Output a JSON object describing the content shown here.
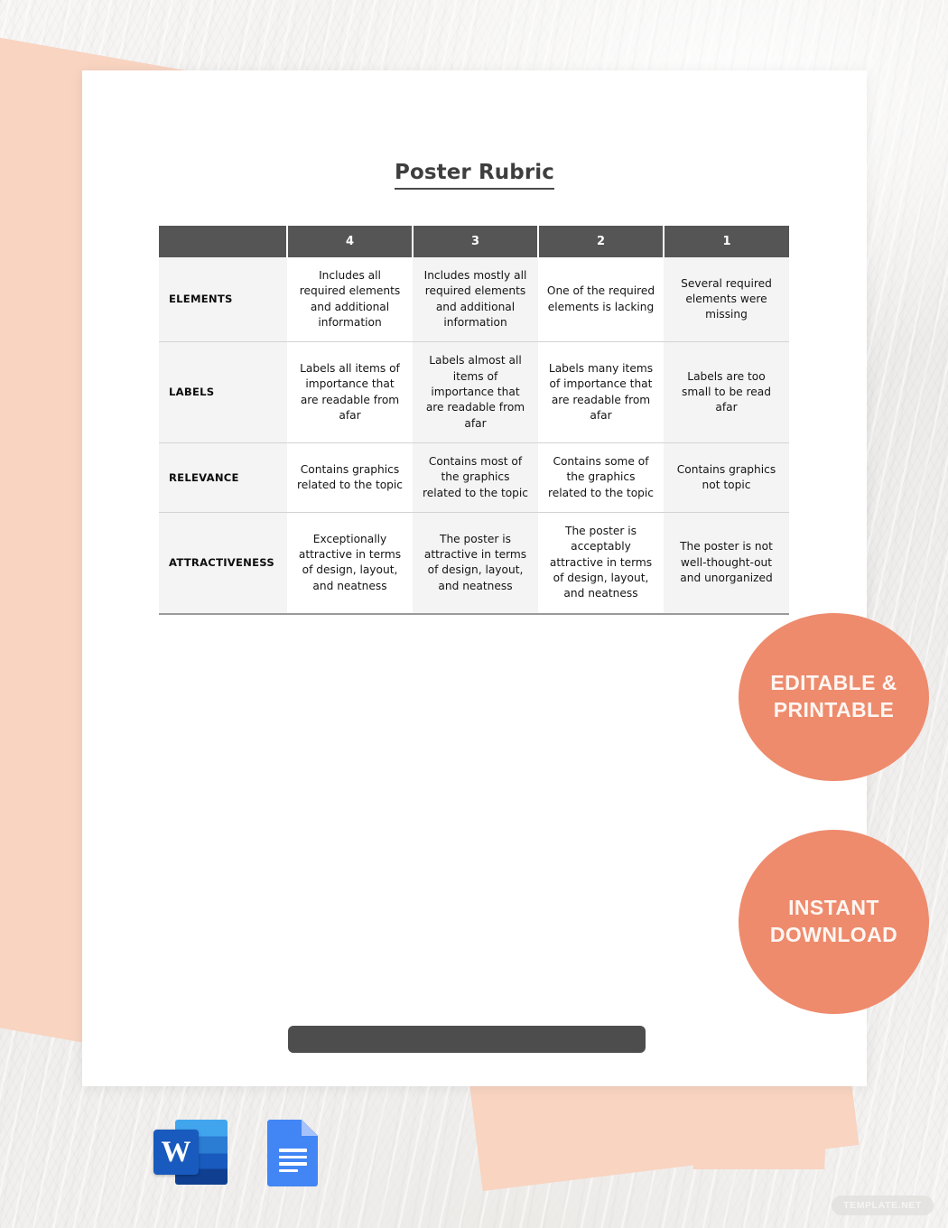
{
  "document": {
    "title": "Poster Rubric"
  },
  "rubric": {
    "type": "table",
    "corner_header": "",
    "score_headers": [
      "4",
      "3",
      "2",
      "1"
    ],
    "criteria": [
      {
        "label": "ELEMENTS",
        "levels": [
          "Includes all required elements and additional information",
          "Includes mostly all required elements and additional information",
          "One of the required elements is lacking",
          "Several required elements were missing"
        ]
      },
      {
        "label": "LABELS",
        "levels": [
          "Labels all items of importance that are readable from afar",
          "Labels almost all items of importance that are readable from afar",
          "Labels many items of importance that are readable from afar",
          "Labels are too small to be read afar"
        ]
      },
      {
        "label": "RELEVANCE",
        "levels": [
          "Contains graphics related to the topic",
          "Contains most of the graphics related to the topic",
          "Contains some of the graphics related to the topic",
          "Contains graphics not topic"
        ]
      },
      {
        "label": "ATTRACTIVENESS",
        "levels": [
          "Exceptionally attractive in terms of design, layout, and neatness",
          "The poster is attractive in terms of design, layout, and neatness",
          "The poster is acceptably attractive in terms of design, layout, and neatness",
          "The poster is not well-thought-out and unorganized"
        ]
      }
    ]
  },
  "promos": [
    {
      "name": "editable-printable",
      "line1": "EDITABLE &",
      "line2": "PRINTABLE"
    },
    {
      "name": "instant-download",
      "line1": "INSTANT",
      "line2": "DOWNLOAD"
    }
  ],
  "file_formats": [
    {
      "icon": "microsoft-word-icon",
      "glyph": "W"
    },
    {
      "icon": "google-docs-icon",
      "glyph": ""
    }
  ],
  "watermark": "TEMPLATE.NET",
  "colors": {
    "accent_circle": "#EE8B6D",
    "peach_shape": "#F8D4C1",
    "table_header": "#555555",
    "table_shade": "#F4F4F4",
    "bottom_bar": "#4D4D4D",
    "title_text": "#3E3E3E"
  }
}
